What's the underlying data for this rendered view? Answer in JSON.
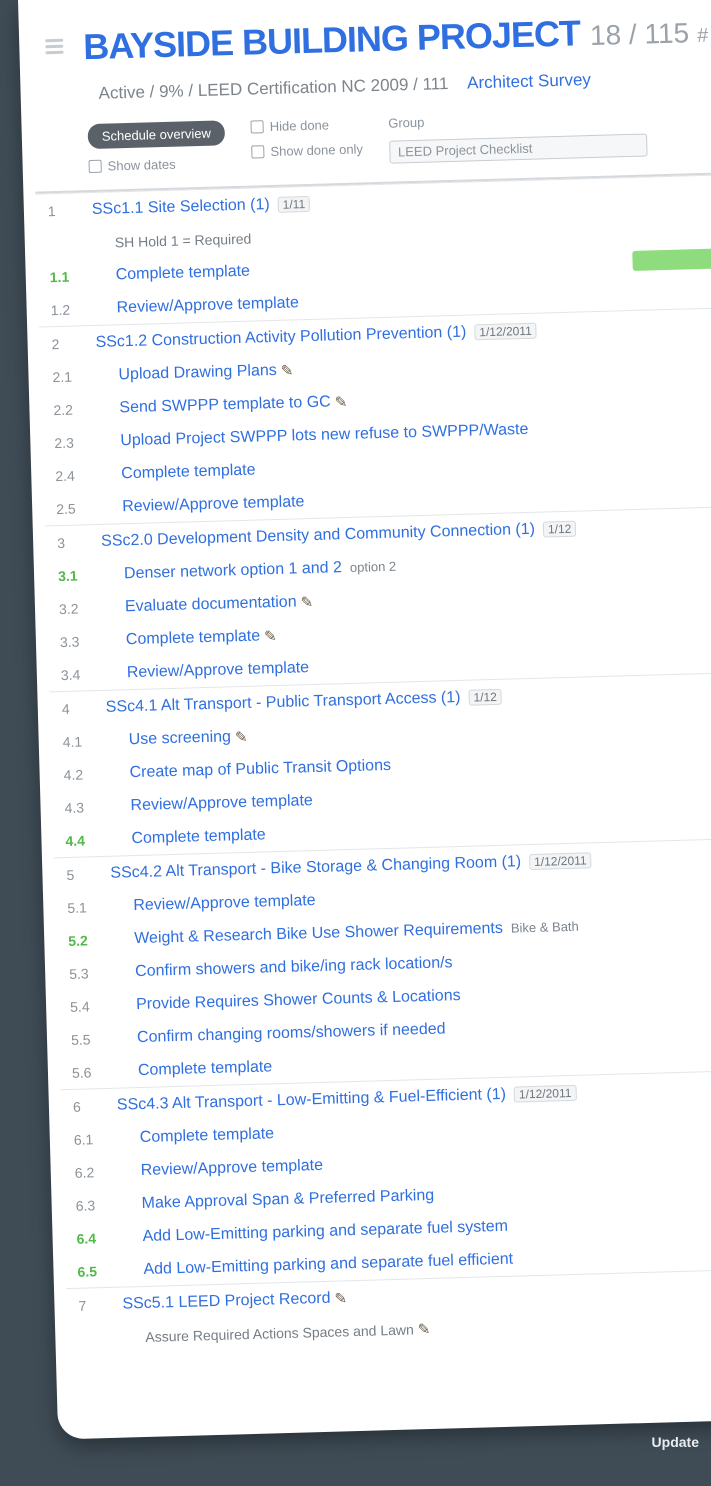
{
  "header": {
    "title": "BAYSIDE BUILDING PROJECT",
    "count": "18 / 115",
    "extra": "# ~~",
    "subtitle": "Active / 9% / LEED Certification NC 2009 / 111",
    "subtitle_link": "Architect Survey"
  },
  "controls": {
    "pill_label": "Schedule overview",
    "show_dates": "Show dates",
    "hide_done": "Hide done",
    "show_done_only": "Show done only",
    "group_label": "Group",
    "group_value": "LEED Project Checklist"
  },
  "colors": {
    "green": "#8fdc7f",
    "purple": "#a8a4f0",
    "orange": "#f7c078",
    "red": "#e89494",
    "lightblue": "#dbe3f6"
  },
  "rows": [
    {
      "num": "1",
      "kind": "phase",
      "label": "SSc1.1 Site Selection (1)",
      "badge": "1/11",
      "bar": null
    },
    {
      "num": "",
      "kind": "note",
      "label": "SH Hold 1 = Required",
      "bar": null
    },
    {
      "num": "1.1",
      "kind": "task",
      "done": true,
      "label": "Complete template",
      "bar": {
        "color": "green",
        "start": 0.5,
        "len": 0.27
      }
    },
    {
      "num": "1.2",
      "kind": "task",
      "label": "Review/Approve template",
      "bar": {
        "color": "purple",
        "start": 0.77,
        "len": 0.25
      }
    },
    {
      "num": "2",
      "kind": "phase",
      "label": "SSc1.2 Construction Activity Pollution Prevention (1)",
      "badge": "1/12/2011",
      "bar": null
    },
    {
      "num": "2.1",
      "kind": "task",
      "label": "Upload Drawing Plans",
      "pen": true,
      "bar": {
        "color": "orange",
        "start": 0.82,
        "len": 0.2
      }
    },
    {
      "num": "2.2",
      "kind": "task",
      "label": "Send SWPPP template to GC",
      "pen": true,
      "bar": {
        "color": "purple",
        "start": 0.97,
        "len": 0.05
      }
    },
    {
      "num": "2.3",
      "kind": "task",
      "label": "Upload Project SWPPP lots new refuse to SWPPP/Waste",
      "bar": null
    },
    {
      "num": "2.4",
      "kind": "task",
      "label": "Complete template",
      "bar": null
    },
    {
      "num": "2.5",
      "kind": "task",
      "label": "Review/Approve template",
      "bar": {
        "color": "lightblue",
        "start": 0.93,
        "len": 0.08
      }
    },
    {
      "num": "3",
      "kind": "phase",
      "label": "SSc2.0 Development Density and Community Connection (1)",
      "badge": "1/12",
      "bar": null
    },
    {
      "num": "3.1",
      "kind": "task",
      "done": true,
      "label": "Denser network option 1 and 2",
      "extra": "option 2",
      "bar": {
        "color": "green",
        "start": 0.78,
        "len": 0.03
      }
    },
    {
      "num": "3.2",
      "kind": "task",
      "label": "Evaluate documentation",
      "pen": true,
      "bar": {
        "color": "red",
        "start": 0.84,
        "len": 0.16
      }
    },
    {
      "num": "3.3",
      "kind": "task",
      "label": "Complete template",
      "pen": true,
      "bar": null
    },
    {
      "num": "3.4",
      "kind": "task",
      "label": "Review/Approve template",
      "bar": null
    },
    {
      "num": "4",
      "kind": "phase",
      "label": "SSc4.1 Alt Transport - Public Transport Access (1)",
      "badge": "1/12",
      "bar": null
    },
    {
      "num": "4.1",
      "kind": "task",
      "label": "Use screening",
      "pen": true,
      "bar": {
        "color": "red",
        "start": 0.7,
        "len": 0.3
      }
    },
    {
      "num": "4.2",
      "kind": "task",
      "label": "Create map of Public Transit Options",
      "bar": {
        "color": "orange",
        "start": 0.89,
        "len": 0.12
      }
    },
    {
      "num": "4.3",
      "kind": "task",
      "label": "Review/Approve template",
      "bar": {
        "color": "green",
        "start": 0.79,
        "len": 0.22
      }
    },
    {
      "num": "4.4",
      "kind": "task",
      "done": true,
      "label": "Complete template",
      "bar": null
    },
    {
      "num": "5",
      "kind": "phase",
      "label": "SSc4.2 Alt Transport - Bike Storage & Changing Room (1)",
      "badge": "1/12/2011",
      "bar": null
    },
    {
      "num": "5.1",
      "kind": "task",
      "label": "Review/Approve template",
      "bar": {
        "color": "green",
        "start": 0.85,
        "len": 0.04
      }
    },
    {
      "num": "5.2",
      "kind": "task",
      "done": true,
      "label": "Weight & Research Bike Use Shower Requirements",
      "extra": "Bike & Bath",
      "bar": {
        "color": "red",
        "start": 0.85,
        "len": 0.16
      }
    },
    {
      "num": "5.3",
      "kind": "task",
      "label": "Confirm showers and bike/ing rack location/s",
      "bar": null
    },
    {
      "num": "5.4",
      "kind": "task",
      "label": "Provide Requires Shower Counts & Locations",
      "bar": null
    },
    {
      "num": "5.5",
      "kind": "task",
      "label": "Confirm changing rooms/showers if needed",
      "bar": {
        "color": "lightblue",
        "start": 0.85,
        "len": 0.16
      }
    },
    {
      "num": "5.6",
      "kind": "task",
      "label": "Complete template",
      "bar": null
    },
    {
      "num": "6",
      "kind": "phase",
      "label": "SSc4.3 Alt Transport - Low-Emitting & Fuel-Efficient (1)",
      "badge": "1/12/2011",
      "bar": null
    },
    {
      "num": "6.1",
      "kind": "task",
      "label": "Complete template",
      "bar": {
        "color": "red",
        "start": 0.86,
        "len": 0.03
      }
    },
    {
      "num": "6.2",
      "kind": "task",
      "label": "Review/Approve template",
      "bar": {
        "color": "green",
        "start": 0.86,
        "len": 0.03
      }
    },
    {
      "num": "6.3",
      "kind": "task",
      "label": "Make Approval Span & Preferred Parking",
      "bar": {
        "color": "green",
        "start": 0.86,
        "len": 0.03
      }
    },
    {
      "num": "6.4",
      "kind": "task",
      "done": true,
      "label": "Add Low-Emitting parking and separate fuel system",
      "bar": {
        "color": "green",
        "start": 0.86,
        "len": 0.03
      }
    },
    {
      "num": "6.5",
      "kind": "task",
      "done": true,
      "label": "Add Low-Emitting parking and separate fuel efficient",
      "bar": null
    },
    {
      "num": "7",
      "kind": "phase",
      "label": "SSc5.1 LEED Project Record",
      "pen": true,
      "bar": null
    },
    {
      "num": "",
      "kind": "note",
      "label": "Assure Required Actions Spaces and Lawn",
      "pen": true,
      "bar": null
    }
  ],
  "footer": {
    "button": "Update"
  }
}
